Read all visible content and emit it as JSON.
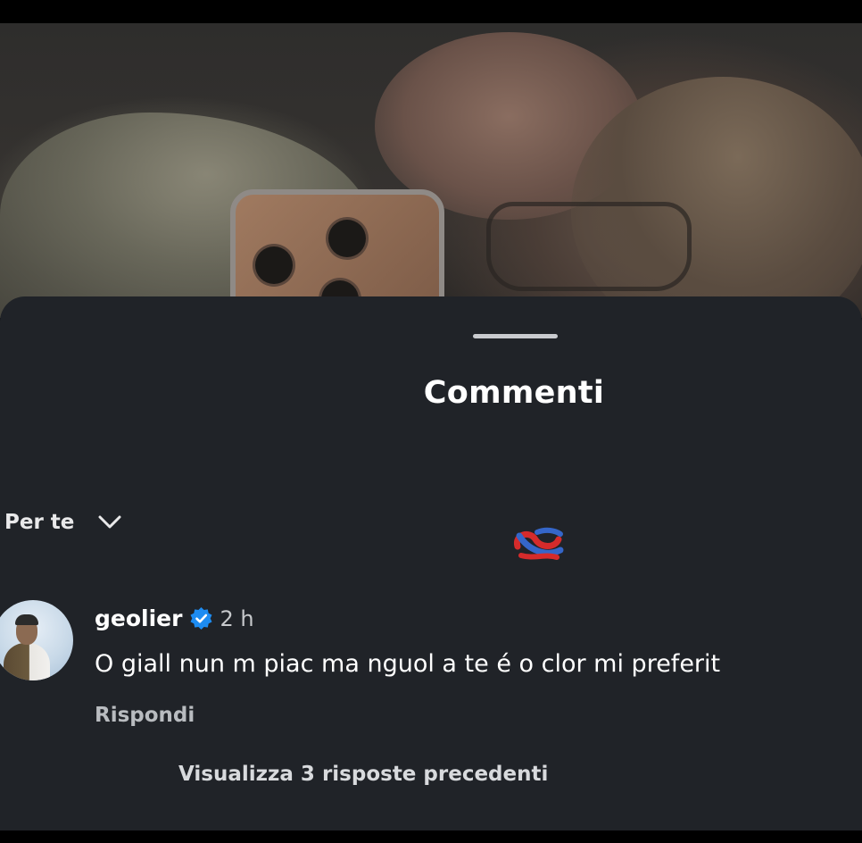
{
  "header": {
    "title": "Commenti"
  },
  "sort": {
    "label": "Per te",
    "icon": "chevron-down-icon"
  },
  "sticker": {
    "icon": "knot-emoji-icon"
  },
  "comment": {
    "username": "geolier",
    "verified_icon": "verified-badge-icon",
    "time": "2 h",
    "text": "O giall nun m piac ma nguol a te é o clor mi preferit",
    "reply_label": "Rispondi"
  },
  "replies": {
    "view_label": "Visualizza 3 risposte precedenti"
  },
  "colors": {
    "sheet_bg": "#202328",
    "verified_blue": "#1d8cf2",
    "primary_text": "#ffffff",
    "secondary_text": "#b9bcc0"
  }
}
